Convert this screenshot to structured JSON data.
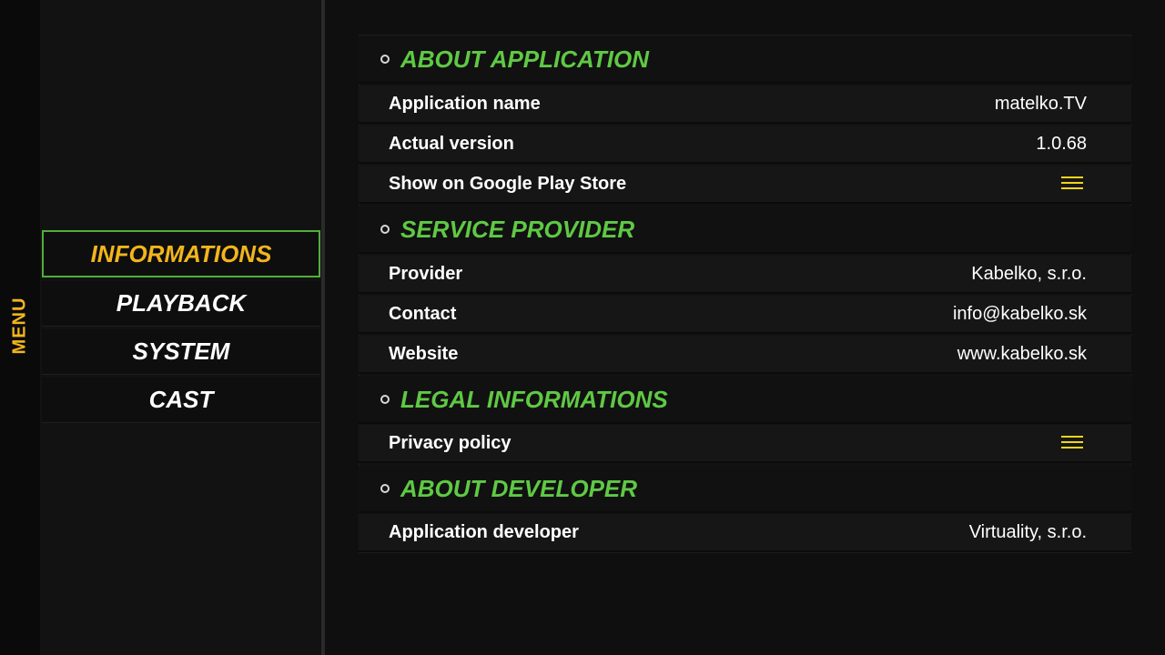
{
  "rail": {
    "label": "MENU",
    "accent": "#f2b51c"
  },
  "menu": {
    "items": [
      {
        "label": "INFORMATIONS",
        "active": true
      },
      {
        "label": "PLAYBACK",
        "active": false
      },
      {
        "label": "SYSTEM",
        "active": false
      },
      {
        "label": "CAST",
        "active": false
      }
    ]
  },
  "sections": {
    "about_application": {
      "title": "ABOUT APPLICATION",
      "rows": [
        {
          "label": "Application name",
          "value": "matelko.TV"
        },
        {
          "label": "Actual version",
          "value": "1.0.68"
        },
        {
          "label": "Show on Google Play Store",
          "icon": "menu-lines-icon"
        }
      ]
    },
    "service_provider": {
      "title": "SERVICE PROVIDER",
      "rows": [
        {
          "label": "Provider",
          "value": "Kabelko, s.r.o."
        },
        {
          "label": "Contact",
          "value": "info@kabelko.sk"
        },
        {
          "label": "Website",
          "value": "www.kabelko.sk"
        }
      ]
    },
    "legal_informations": {
      "title": "LEGAL INFORMATIONS",
      "rows": [
        {
          "label": "Privacy policy",
          "icon": "menu-lines-icon"
        }
      ]
    },
    "about_developer": {
      "title": "ABOUT DEVELOPER",
      "rows": [
        {
          "label": "Application developer",
          "value": "Virtuality, s.r.o."
        }
      ]
    }
  },
  "colors": {
    "section_title": "#5fc944",
    "active_border": "#4fae3a",
    "active_text": "#f2b51c",
    "icon": "#f2d51c"
  }
}
